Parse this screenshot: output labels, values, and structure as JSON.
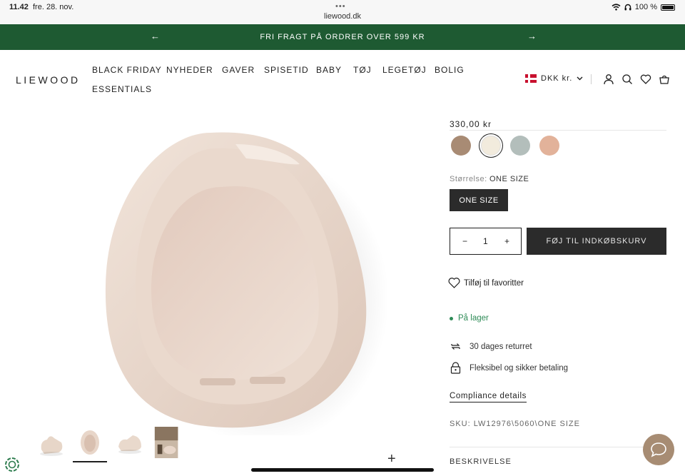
{
  "status_bar": {
    "time": "11.42",
    "date": "fre. 28. nov.",
    "url": "liewood.dk",
    "battery": "100 %"
  },
  "announcement": {
    "text": "FRI FRAGT PÅ ORDRER OVER 599 KR"
  },
  "header": {
    "logo": "LIEWOOD",
    "nav": [
      "BLACK FRIDAY",
      "NYHEDER",
      "GAVER",
      "SPISETID",
      "BABY",
      "TØJ",
      "LEGETØJ",
      "BOLIG",
      "ESSENTIALS"
    ],
    "currency": "DKK kr."
  },
  "product": {
    "price": "330,00 kr",
    "swatches": [
      {
        "color": "#a88b74"
      },
      {
        "color": "#f2ebdd"
      },
      {
        "color": "#b3bebb"
      },
      {
        "color": "#e2b29a"
      }
    ],
    "selected_swatch": 1,
    "size_label": "Størrelse:",
    "size_value": "ONE SIZE",
    "size_option": "ONE SIZE",
    "quantity": "1",
    "add_to_cart": "FØJ TIL INDKØBSKURV",
    "favorite": "Tilføj til favoritter",
    "stock": "På lager",
    "returns": "30 dages returret",
    "payment": "Fleksibel og sikker betaling",
    "compliance": "Compliance details",
    "sku": "SKU: LW12976\\5060\\ONE SIZE",
    "description": "BESKRIVELSE"
  },
  "colors": {
    "announcement_bg": "#1e5a32",
    "stock_green": "#2e8b57",
    "button_dark": "#2b2b2b",
    "chat_bg": "#a78c73"
  }
}
